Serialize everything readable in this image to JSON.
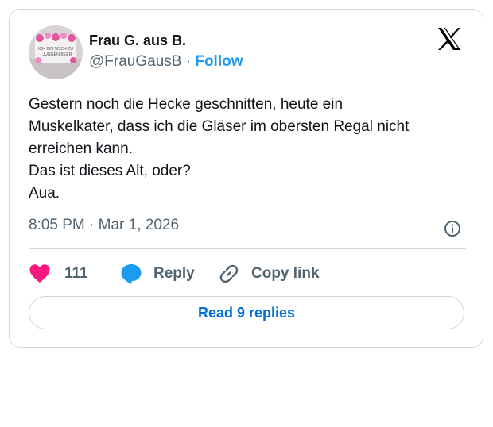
{
  "tweet": {
    "author_name": "Frau G. aus B.",
    "handle": "@FrauGausB",
    "separator": "·",
    "follow_label": "Follow",
    "avatar_text_line1": "ICH BIN NOCH ZU",
    "avatar_text_line2": "JUNGEN BEER",
    "lines": [
      "Gestern noch die Hecke geschnitten, heute ein",
      "Muskelkater, dass ich die Gläser im obersten Regal nicht",
      "erreichen kann.",
      "Das ist dieses Alt, oder?",
      "Aua."
    ],
    "timestamp": "8:05 PM · Mar 1, 2026",
    "actions": {
      "like_count": "111",
      "reply_label": "Reply",
      "copy_label": "Copy link"
    },
    "read_replies_label": "Read 9 replies"
  },
  "colors": {
    "accent": "#1d9bf0",
    "heart": "#f91880",
    "read_link": "#006fd6",
    "muted": "#536471",
    "border": "#cfd9de"
  },
  "icons": [
    "x-logo-icon",
    "info-icon",
    "heart-icon",
    "reply-bubble-icon",
    "link-icon"
  ]
}
